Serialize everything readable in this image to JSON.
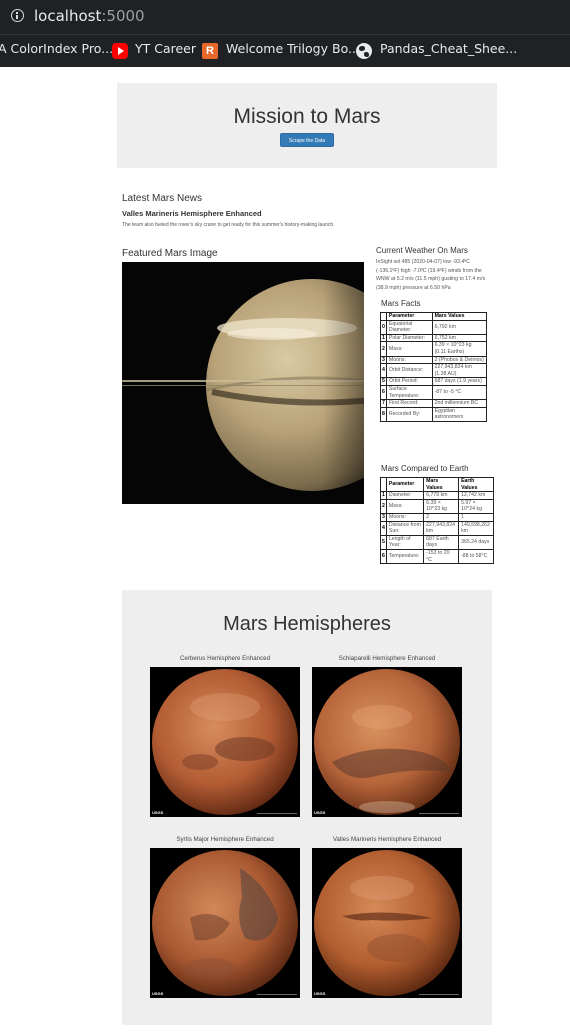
{
  "browser": {
    "url_host": "localhost",
    "url_port": ":5000",
    "bookmarks": [
      {
        "label": "A ColorIndex Pro...",
        "icon": "none"
      },
      {
        "label": "YT Career",
        "icon": "youtube-icon"
      },
      {
        "label": "Welcome Trilogy Bo...",
        "icon": "trilogy-r-icon"
      },
      {
        "label": "Pandas_Cheat_Shee...",
        "icon": "globe-icon"
      }
    ]
  },
  "jumbotron": {
    "title": "Mission to Mars",
    "button_label": "Scrape the Data",
    "button_color": "#337ab7"
  },
  "news": {
    "heading": "Latest Mars News",
    "title": "Valles Marineris Hemisphere Enhanced",
    "paragraph": "The team also fueled the rover's sky crane to get ready for this summer's history-making launch."
  },
  "featured": {
    "heading": "Featured Mars Image"
  },
  "weather": {
    "heading": "Current Weather On Mars",
    "text": "InSight sol 485 (2020-04-07) low -93.4ºC (-136.1ºF) high -7.0ºC (19.4ºF) winds from the WNW at 5.2 m/s (11.5 mph) gusting to 17.4 m/s (38.9 mph) pressure at 6.50 hPa"
  },
  "facts": {
    "heading": "Mars Facts",
    "headers": [
      "",
      "Parameter",
      "Mars Values"
    ],
    "rows": [
      [
        "0",
        "Equatorial Diameter:",
        "6,792 km"
      ],
      [
        "1",
        "Polar Diameter:",
        "6,752 km"
      ],
      [
        "2",
        "Mass:",
        "6.39 × 10^23 kg (0.11 Earths)"
      ],
      [
        "3",
        "Moons:",
        "2 (Phobos & Deimos)"
      ],
      [
        "4",
        "Orbit Distance:",
        "227,943,824 km (1.38 AU)"
      ],
      [
        "5",
        "Orbit Period:",
        "687 days (1.9 years)"
      ],
      [
        "6",
        "Surface Temperature:",
        "-87 to -5 °C"
      ],
      [
        "7",
        "First Record:",
        "2nd millennium BC"
      ],
      [
        "8",
        "Recorded By:",
        "Egyptian astronomers"
      ]
    ]
  },
  "compare": {
    "heading": "Mars Compared to Earth",
    "headers": [
      "",
      "Parameter",
      "Mars Values",
      "Earth Values"
    ],
    "rows": [
      [
        "1",
        "Diameter:",
        "6,779 km",
        "12,742 km"
      ],
      [
        "2",
        "Mass:",
        "6.39 × 10^23 kg",
        "5.97 × 10^24 kg"
      ],
      [
        "3",
        "Moons:",
        "2",
        "1"
      ],
      [
        "4",
        "Distance from Sun:",
        "227,943,824 km",
        "149,598,262 km"
      ],
      [
        "5",
        "Length of Year:",
        "687 Earth days",
        "365.24 days"
      ],
      [
        "6",
        "Temperature:",
        "-153 to 20 °C",
        "-88 to 58°C"
      ]
    ]
  },
  "hemispheres": {
    "heading": "Mars Hemispheres",
    "items": [
      {
        "title": "Cerberus Hemisphere Enhanced"
      },
      {
        "title": "Schiaparelli Hemisphere Enhanced"
      },
      {
        "title": "Syrtis Major Hemisphere Enhanced"
      },
      {
        "title": "Valles Marineris Hemisphere Enhanced"
      }
    ],
    "logo_text": "USGS"
  }
}
